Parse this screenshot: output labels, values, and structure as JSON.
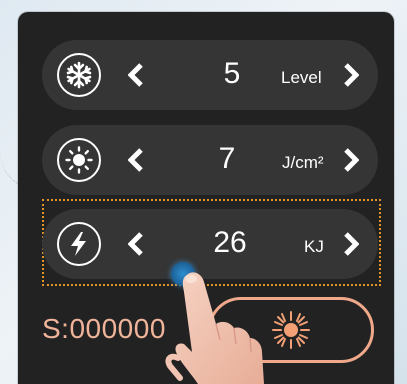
{
  "controls": [
    {
      "icon": "snowflake-icon",
      "value": "5",
      "unit": "Level"
    },
    {
      "icon": "sun-icon",
      "value": "7",
      "unit": "J/cm²"
    },
    {
      "icon": "lightning-bolt-icon",
      "value": "26",
      "unit": "KJ"
    }
  ],
  "counter": {
    "text": "S:000000"
  },
  "laser_button": {
    "icon": "laser-burst-icon"
  },
  "colors": {
    "background": "#222222",
    "row": "#353535",
    "accent": "#efa98a",
    "selection": "#e49426",
    "text": "#ffffff"
  }
}
